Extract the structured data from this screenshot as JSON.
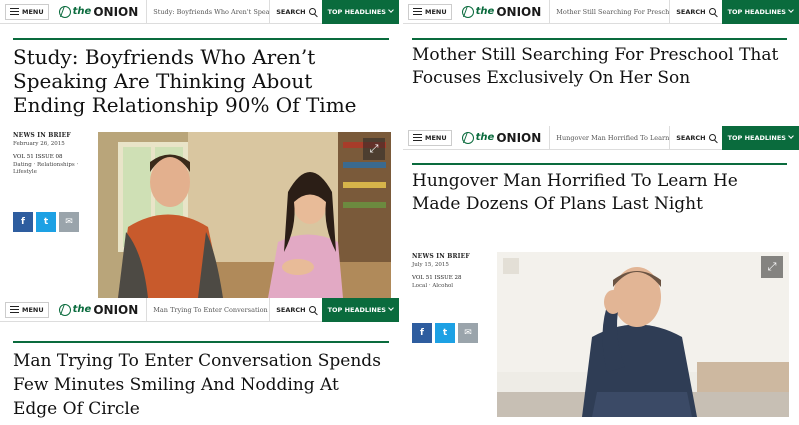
{
  "nav": {
    "menu_label": "MENU",
    "logo_the": "the",
    "logo_name": "ONION",
    "search_label": "SEARCH",
    "top_headlines_label": "TOP HEADLINES"
  },
  "panel1": {
    "breadcrumb": "Study: Boyfriends Who Aren't Speakin",
    "headline": "Study: Boyfriends Who Aren’t Speaking Are Thinking About Ending Relationship 90% Of Time",
    "kicker": "NEWS IN BRIEF",
    "date": "February 26, 2015",
    "issue": "VOL 51 ISSUE 08",
    "tags": "Dating · Relationships · Lifestyle"
  },
  "panel2": {
    "breadcrumb": "Man Trying To Enter Conversation Spends I",
    "headline": "Man Trying To Enter Conversation Spends Few Minutes Smiling And Nodding At Edge Of Circle"
  },
  "panel3": {
    "breadcrumb": "Mother Still Searching For Preschool That F",
    "headline": "Mother Still Searching For Preschool That Focuses Exclusively On Her Son"
  },
  "panel4": {
    "breadcrumb": "Hungover Man Horrified To Learn He Made",
    "headline": "Hungover Man Horrified To Learn He Made Dozens Of Plans Last Night",
    "kicker": "NEWS IN BRIEF",
    "date": "July 15, 2015",
    "issue": "VOL 51 ISSUE 28",
    "tags": "Local · Alcohol"
  },
  "share": {
    "facebook": "f",
    "twitter": "t",
    "email": "✉"
  },
  "colors": {
    "brand_green": "#0a6b3d",
    "facebook": "#2e5d9f",
    "twitter": "#1da1e4",
    "email": "#9aa4ab"
  },
  "icons": [
    "hamburger-icon",
    "onion-globe-icon",
    "search-icon",
    "chevron-down-icon",
    "expand-icon",
    "facebook-icon",
    "twitter-icon",
    "email-icon"
  ]
}
